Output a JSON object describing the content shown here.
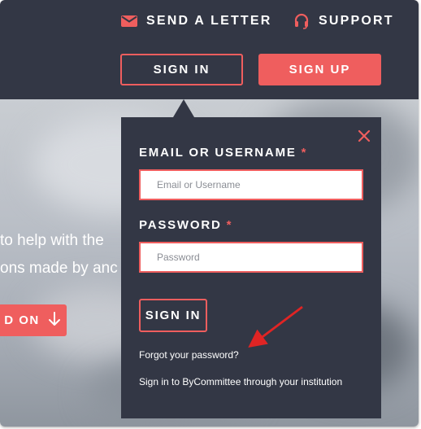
{
  "colors": {
    "dark": "#333745",
    "accent": "#ef5e5e",
    "white": "#ffffff"
  },
  "nav": {
    "send_letter": {
      "label": "SEND A LETTER",
      "icon": "envelope-icon"
    },
    "support": {
      "label": "SUPPORT",
      "icon": "headset-icon"
    },
    "sign_in": "SIGN IN",
    "sign_up": "SIGN UP"
  },
  "hero": {
    "line1": "to help with the",
    "line2": "ons made by anc",
    "cta_label": "D ON",
    "cta_icon": "arrow-down-icon"
  },
  "login": {
    "close_icon": "close-icon",
    "email_label": "EMAIL OR USERNAME",
    "email_required": "*",
    "email_placeholder": "Email or Username",
    "email_value": "",
    "password_label": "PASSWORD",
    "password_required": "*",
    "password_placeholder": "Password",
    "password_value": "",
    "submit": "SIGN IN",
    "forgot": "Forgot your password?",
    "institution": "Sign in to ByCommittee through your institution"
  }
}
